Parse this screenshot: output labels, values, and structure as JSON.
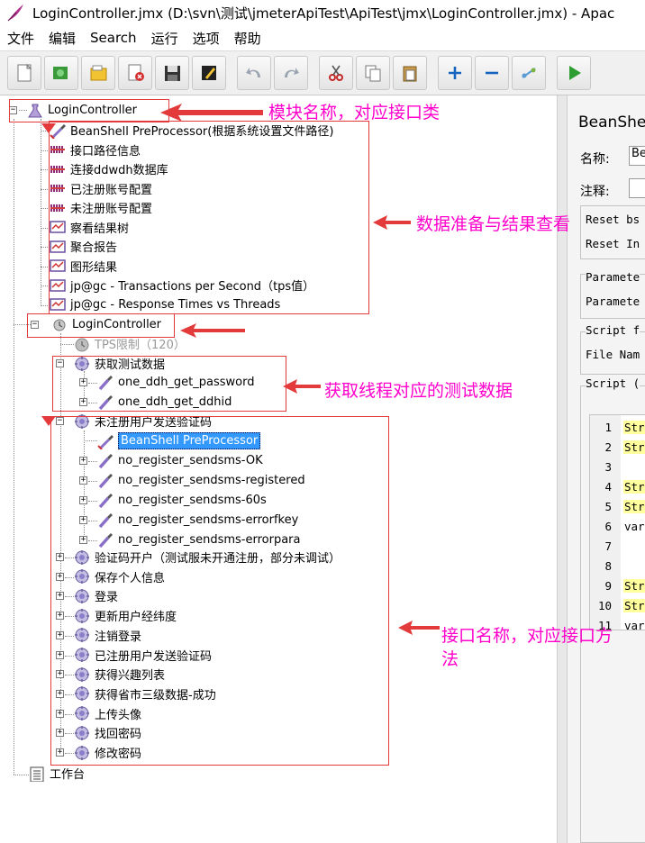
{
  "window": {
    "title": "LoginController.jmx (D:\\svn\\测试\\jmeterApiTest\\ApiTest\\jmx\\LoginController.jmx) - Apac"
  },
  "menu": [
    "文件",
    "编辑",
    "Search",
    "运行",
    "选项",
    "帮助"
  ],
  "toolbar": {
    "buttons": [
      {
        "icon": "new-file-icon"
      },
      {
        "icon": "templates-icon"
      },
      {
        "icon": "open-icon"
      },
      {
        "icon": "close-icon"
      },
      {
        "icon": "save-icon"
      },
      {
        "icon": "edit-icon"
      },
      {
        "icon": "undo-icon"
      },
      {
        "icon": "redo-icon"
      },
      {
        "icon": "cut-icon"
      },
      {
        "icon": "copy-icon"
      },
      {
        "icon": "paste-icon"
      },
      {
        "icon": "expand-icon"
      },
      {
        "icon": "collapse-icon"
      },
      {
        "icon": "toggle-icon"
      },
      {
        "icon": "start-icon"
      }
    ]
  },
  "tree": {
    "root": "LoginController",
    "pre_nodes": [
      {
        "label": "BeanShell PreProcessor(根据系统设置文件路径)",
        "icon": "preprocessor"
      },
      {
        "label": "接口路径信息",
        "icon": "config"
      },
      {
        "label": "连接ddwdh数据库",
        "icon": "config"
      },
      {
        "label": "已注册账号配置",
        "icon": "config"
      },
      {
        "label": "未注册账号配置",
        "icon": "config"
      },
      {
        "label": "察看结果树",
        "icon": "listener"
      },
      {
        "label": "聚合报告",
        "icon": "listener"
      },
      {
        "label": "图形结果",
        "icon": "listener"
      },
      {
        "label": "jp@gc - Transactions per Second（tps值）",
        "icon": "listener"
      },
      {
        "label": "jp@gc - Response Times vs Threads",
        "icon": "listener"
      }
    ],
    "thread_group": "LoginController",
    "tps_limit": "TPS限制（120）",
    "test_data_group": {
      "label": "获取测试数据",
      "children": [
        "one_ddh_get_password",
        "one_ddh_get_ddhid"
      ]
    },
    "sms_group": {
      "label": "未注册用户发送验证码",
      "selected_child": "BeanShell PreProcessor",
      "children": [
        "no_register_sendsms-OK",
        "no_register_sendsms-registered",
        "no_register_sendsms-60s",
        "no_register_sendsms-errorfkey",
        "no_register_sendsms-errorpara"
      ]
    },
    "other_groups": [
      "验证码开户（测试服未开通注册，部分未调试）",
      "保存个人信息",
      "登录",
      "更新用户经纬度",
      "注销登录",
      "已注册用户发送验证码",
      "获得兴趣列表",
      "获得省市三级数据-成功",
      "上传头像",
      "找回密码",
      "修改密码"
    ],
    "workbench": "工作台"
  },
  "annotations": {
    "module": "模块名称，对应接口类",
    "data_prep": "数据准备与结果查看",
    "test_data": "获取线程对应的测试数据",
    "interface_line1": "接口名称，对应接口方",
    "interface_line2": "法"
  },
  "right_panel": {
    "title": "BeanShe",
    "name_label": "名称:",
    "name_value": "Be",
    "comment_label": "注释:",
    "reset_bsh": "Reset bs",
    "reset_in": "Reset In",
    "params_group": "Paramete",
    "params_label": "Paramete",
    "script_file_group": "Script f",
    "file_name_label": "File Nam",
    "script_group": "Script (",
    "code_lines": [
      {
        "n": "1",
        "text": "Str",
        "hl": true
      },
      {
        "n": "2",
        "text": "Str",
        "hl": true
      },
      {
        "n": "3",
        "text": "",
        "hl": false
      },
      {
        "n": "4",
        "text": "Str",
        "hl": true
      },
      {
        "n": "5",
        "text": "Str",
        "hl": true
      },
      {
        "n": "6",
        "text": "var",
        "hl": false
      },
      {
        "n": "7",
        "text": "",
        "hl": false
      },
      {
        "n": "8",
        "text": "",
        "hl": false
      },
      {
        "n": "9",
        "text": "Str",
        "hl": true
      },
      {
        "n": "10",
        "text": "Str",
        "hl": true
      },
      {
        "n": "11",
        "text": "var",
        "hl": false
      }
    ]
  },
  "colors": {
    "annotation": "#ff00cc",
    "box": "#e33b3b",
    "selection": "#3399ff"
  }
}
